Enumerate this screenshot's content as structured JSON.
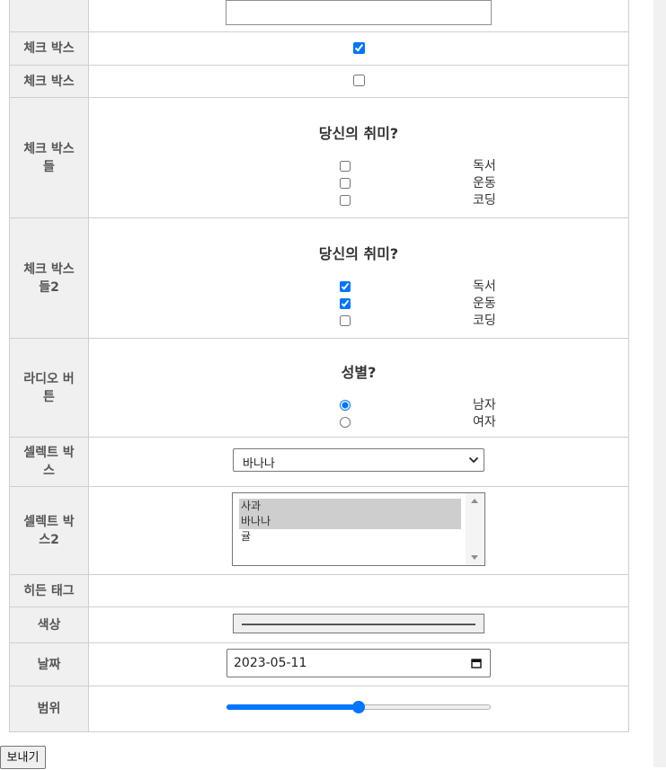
{
  "rows": {
    "checkbox1": {
      "label": "체크 박스",
      "checked": true
    },
    "checkbox2": {
      "label": "체크 박스",
      "checked": false
    },
    "checkboxes": {
      "label": "체크 박스\n들",
      "title": "당신의 취미?",
      "options": [
        {
          "label": "독서",
          "checked": false
        },
        {
          "label": "운동",
          "checked": false
        },
        {
          "label": "코딩",
          "checked": false
        }
      ]
    },
    "checkboxes2": {
      "label": "체크 박스\n들2",
      "title": "당신의 취미?",
      "options": [
        {
          "label": "독서",
          "checked": true
        },
        {
          "label": "운동",
          "checked": true
        },
        {
          "label": "코딩",
          "checked": false
        }
      ]
    },
    "radio": {
      "label": "라디오 버\n튼",
      "title": "성별?",
      "options": [
        {
          "label": "남자",
          "checked": true
        },
        {
          "label": "여자",
          "checked": false
        }
      ]
    },
    "select": {
      "label": "셀렉트 박\n스",
      "selected": "바나나"
    },
    "select2": {
      "label": "셀렉트 박\n스2",
      "options": [
        {
          "label": "사과",
          "selected": true
        },
        {
          "label": "바나나",
          "selected": true
        },
        {
          "label": "귤",
          "selected": false
        }
      ]
    },
    "hidden": {
      "label": "히든 태그"
    },
    "color": {
      "label": "색상",
      "value": "#555555"
    },
    "date": {
      "label": "날짜",
      "value": "2023-05-11"
    },
    "range": {
      "label": "범위",
      "value_percent": 50
    }
  },
  "submit_label": "보내기",
  "colors": {
    "accent": "#0075ff",
    "label_bg": "#f0f0f0",
    "border": "#cfcfcf"
  }
}
